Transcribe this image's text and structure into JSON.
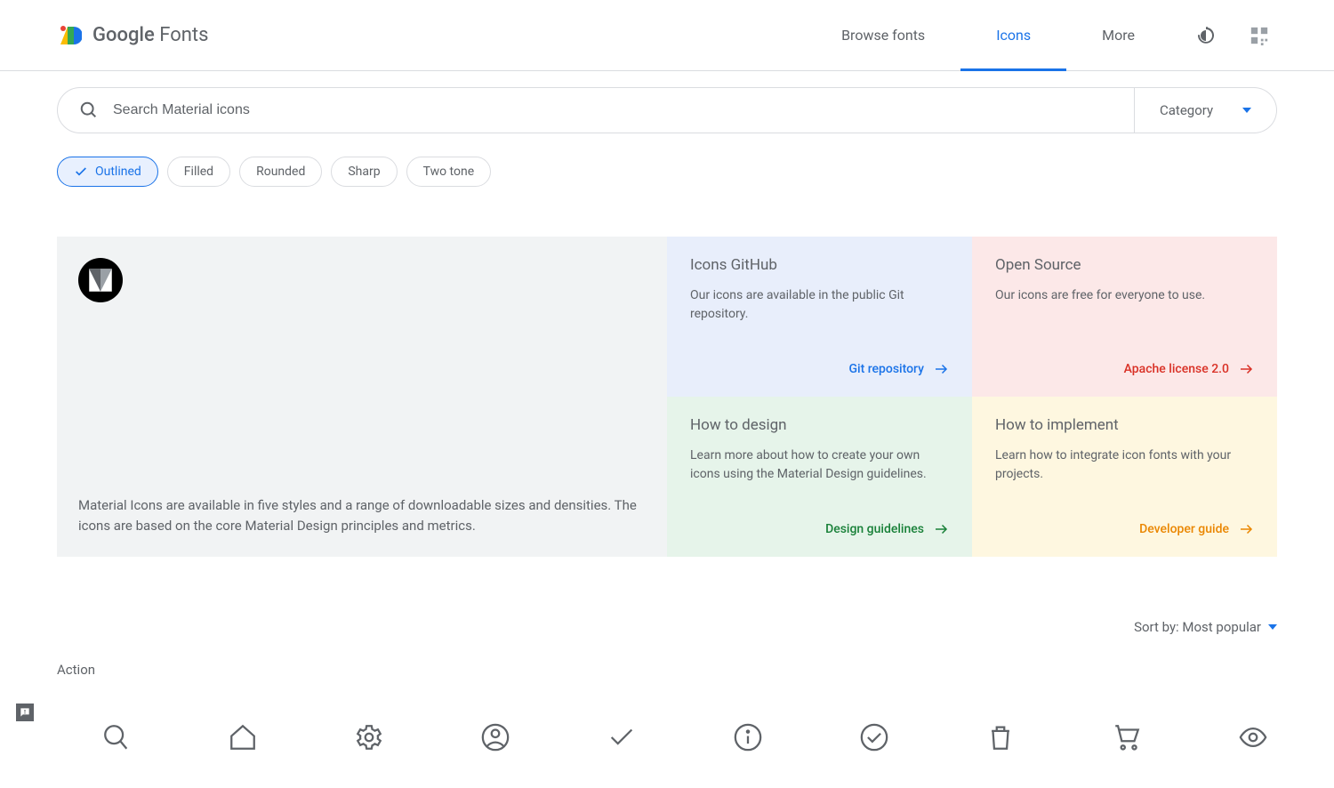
{
  "header": {
    "logo_text_1": "Google",
    "logo_text_2": " Fonts",
    "nav": [
      {
        "label": "Browse fonts",
        "active": false
      },
      {
        "label": "Icons",
        "active": true
      },
      {
        "label": "More",
        "active": false
      }
    ]
  },
  "search": {
    "placeholder": "Search Material icons",
    "category_label": "Category"
  },
  "chips": [
    {
      "label": "Outlined",
      "active": true,
      "check": true
    },
    {
      "label": "Filled",
      "active": false
    },
    {
      "label": "Rounded",
      "active": false
    },
    {
      "label": "Sharp",
      "active": false
    },
    {
      "label": "Two tone",
      "active": false
    }
  ],
  "hero": {
    "description": "Material Icons are available in five styles and a range of downloadable sizes and densities. The icons are based on the core Material Design principles and metrics."
  },
  "cards": {
    "github": {
      "title": "Icons GitHub",
      "desc": "Our icons are available in the public Git repository.",
      "link": "Git repository"
    },
    "opensource": {
      "title": "Open Source",
      "desc": "Our icons are free for everyone to use.",
      "link": "Apache license 2.0"
    },
    "design": {
      "title": "How to design",
      "desc": "Learn more about how to create your own icons using the Material Design guidelines.",
      "link": "Design guidelines"
    },
    "implement": {
      "title": "How to implement",
      "desc": "Learn how to integrate icon fonts with your projects.",
      "link": "Developer guide"
    }
  },
  "sort": {
    "prefix": "Sort by: ",
    "value": "Most popular"
  },
  "section": {
    "title": "Action"
  }
}
